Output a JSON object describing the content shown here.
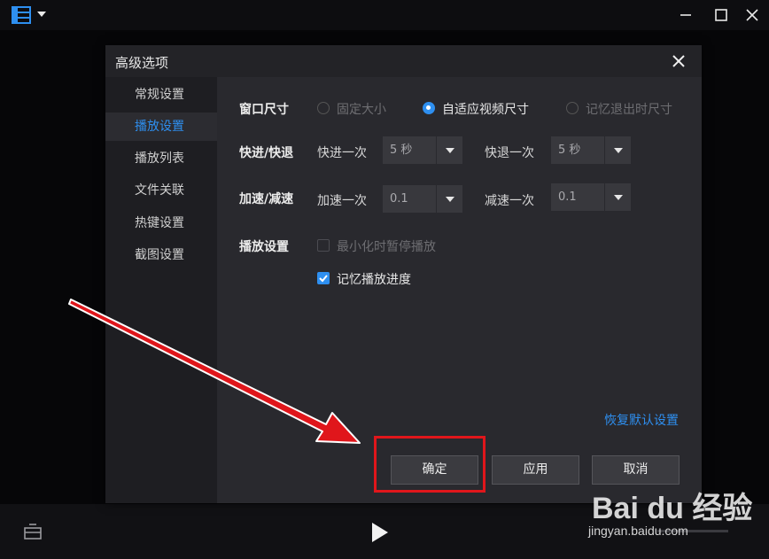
{
  "dialog": {
    "title": "高级选项"
  },
  "sidebar": {
    "items": [
      {
        "label": "常规设置",
        "active": false
      },
      {
        "label": "播放设置",
        "active": true
      },
      {
        "label": "播放列表",
        "active": false
      },
      {
        "label": "文件关联",
        "active": false
      },
      {
        "label": "热键设置",
        "active": false
      },
      {
        "label": "截图设置",
        "active": false
      }
    ]
  },
  "window_size": {
    "label": "窗口尺寸",
    "options": [
      {
        "label": "固定大小",
        "selected": false
      },
      {
        "label": "自适应视频尺寸",
        "selected": true
      },
      {
        "label": "记忆退出时尺寸",
        "selected": false
      }
    ]
  },
  "seek": {
    "label": "快进/快退",
    "forward_label": "快进一次",
    "forward_value": "5 秒",
    "backward_label": "快退一次",
    "backward_value": "5 秒"
  },
  "speed": {
    "label": "加速/减速",
    "up_label": "加速一次",
    "up_value": "0.1",
    "down_label": "减速一次",
    "down_value": "0.1"
  },
  "playback": {
    "label": "播放设置",
    "options": [
      {
        "label": "最小化时暂停播放",
        "checked": false
      },
      {
        "label": "记忆播放进度",
        "checked": true
      }
    ]
  },
  "restore_defaults": "恢复默认设置",
  "buttons": {
    "ok": "确定",
    "apply": "应用",
    "cancel": "取消"
  },
  "watermark": {
    "brand": "Bai du 经验",
    "url": "jingyan.baidu.com"
  },
  "colors": {
    "accent": "#2e8ff0",
    "annotation": "#e0161b"
  }
}
